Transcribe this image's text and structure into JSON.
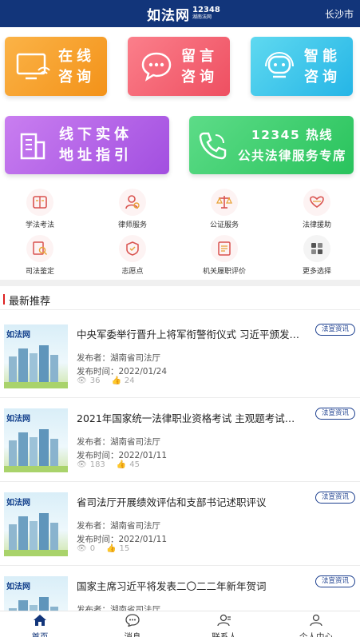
{
  "header": {
    "logo": "如法网",
    "logo_num": "12348",
    "logo_sub": "湖南法网",
    "city": "长沙市"
  },
  "big_buttons": [
    {
      "line1": "在线",
      "line2": "咨询"
    },
    {
      "line1": "留言",
      "line2": "咨询"
    },
    {
      "line1": "智能",
      "line2": "咨询"
    },
    {
      "line1": "线下实体",
      "line2": "地址指引"
    },
    {
      "line1": "12345 热线",
      "line2": "公共法律服务专席"
    }
  ],
  "services": [
    {
      "label": "学法考法",
      "icon": "book-icon"
    },
    {
      "label": "律师服务",
      "icon": "lawyer-icon"
    },
    {
      "label": "公证服务",
      "icon": "scales-icon"
    },
    {
      "label": "法律援助",
      "icon": "heart-hands-icon"
    },
    {
      "label": "司法鉴定",
      "icon": "magnifier-icon"
    },
    {
      "label": "志愿点",
      "icon": "badge-icon"
    },
    {
      "label": "机关履职评价",
      "icon": "document-icon"
    },
    {
      "label": "更多选择",
      "icon": "grid-icon"
    }
  ],
  "section_title": "最新推荐",
  "news": [
    {
      "title": "中央军委举行晋升上将军衔警衔仪式 习近平颁发命…",
      "tag": "法宣资讯",
      "publisher": "发布者：湖南省司法厅",
      "date": "发布时间：2022/01/24",
      "views": "36",
      "likes": "24"
    },
    {
      "title": "2021年国家统一法律职业资格考试 主观题考试成…",
      "tag": "法宣资讯",
      "publisher": "发布者：湖南省司法厅",
      "date": "发布时间：2022/01/11",
      "views": "183",
      "likes": "45"
    },
    {
      "title": "省司法厅开展绩效评估和支部书记述职评议",
      "tag": "法宣资讯",
      "publisher": "发布者：湖南省司法厅",
      "date": "发布时间：2022/01/11",
      "views": "0",
      "likes": "15"
    },
    {
      "title": "国家主席习近平将发表二〇二二年新年贺词",
      "tag": "法宣资讯",
      "publisher": "发布者：湖南省司法厅",
      "date": "",
      "views": "",
      "likes": ""
    }
  ],
  "thumb_logo": "如法网",
  "tabs": [
    {
      "label": "首页",
      "icon": "home-icon"
    },
    {
      "label": "消息",
      "icon": "message-icon"
    },
    {
      "label": "联系人",
      "icon": "contacts-icon"
    },
    {
      "label": "个人中心",
      "icon": "user-icon"
    }
  ],
  "colors": {
    "primary": "#12357a",
    "orange": "#f39219",
    "pink": "#ee4f61",
    "cyan": "#25b5e6",
    "purple": "#a24fe0",
    "green": "#29c35c"
  }
}
